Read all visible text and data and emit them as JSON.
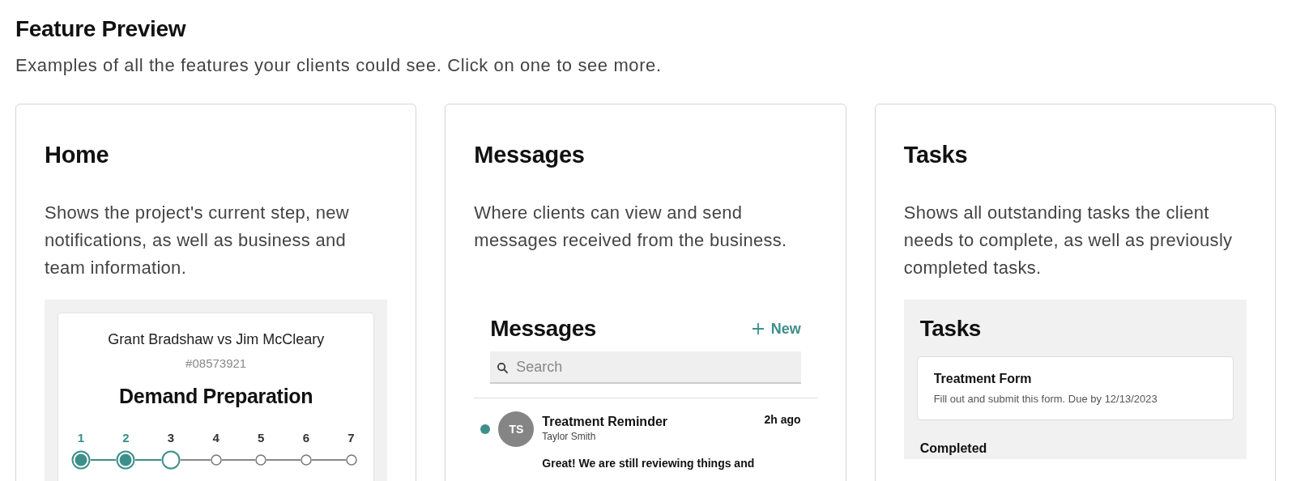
{
  "title": "Feature Preview",
  "subtitle": "Examples of all the features your clients could see. Click on one to see more.",
  "cards": [
    {
      "kind": "home",
      "title": "Home",
      "description": "Shows the project's current step, new notifications, as well as business and team information.",
      "preview": {
        "case_name": "Grant Bradshaw vs Jim McCleary",
        "case_number": "#08573921",
        "stage": "Demand Preparation",
        "steps": [
          {
            "label": "1",
            "done": true,
            "current": false
          },
          {
            "label": "2",
            "done": true,
            "current": false
          },
          {
            "label": "3",
            "done": false,
            "current": true
          },
          {
            "label": "4",
            "done": false,
            "current": false
          },
          {
            "label": "5",
            "done": false,
            "current": false
          },
          {
            "label": "6",
            "done": false,
            "current": false
          },
          {
            "label": "7",
            "done": false,
            "current": false
          }
        ]
      }
    },
    {
      "kind": "messages",
      "title": "Messages",
      "description": "Where clients can view and send messages received from the business.",
      "preview": {
        "heading": "Messages",
        "new_label": "New",
        "search": {
          "placeholder": "Search"
        },
        "messages": [
          {
            "unread": true,
            "initials": "TS",
            "subject": "Treatment Reminder",
            "sender": "Taylor Smith",
            "time": "2h ago",
            "excerpt": "Great! We are still reviewing things and"
          }
        ]
      }
    },
    {
      "kind": "tasks",
      "title": "Tasks",
      "description": "Shows all outstanding tasks the client needs to complete, as well as previously completed tasks.",
      "preview": {
        "heading": "Tasks",
        "tasks": [
          {
            "name": "Treatment Form",
            "detail": "Fill out and submit this form. Due by 12/13/2023"
          }
        ],
        "completed_heading": "Completed"
      }
    }
  ]
}
